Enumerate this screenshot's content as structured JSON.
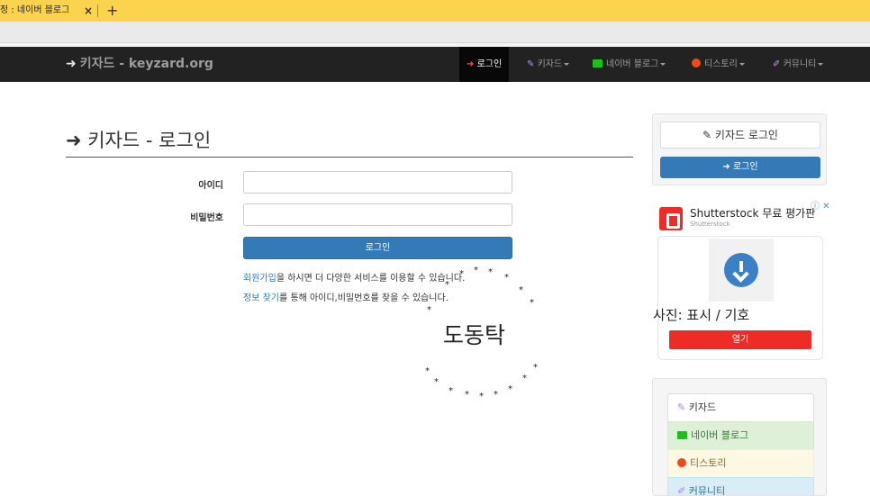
{
  "browser": {
    "tab_title": "정 : 네이버 블로그",
    "tab_close": "×",
    "new_tab": "+"
  },
  "navbar": {
    "brand": "키자드 - keyzard.org",
    "items": [
      {
        "label": "로그인"
      },
      {
        "label": "키자드"
      },
      {
        "label": "네이버 블로그"
      },
      {
        "label": "티스토리"
      },
      {
        "label": "커뮤니티"
      }
    ]
  },
  "login": {
    "title": "키자드 - 로그인",
    "id_label": "아이디",
    "id_value": "",
    "pw_label": "비밀번호",
    "pw_value": "",
    "button": "로그인",
    "signup_link": "회원가입",
    "signup_text": "을 하시면 더 다양한 서비스를 이용할 수 있습니다.",
    "find_link": "정보 찾기",
    "find_text": "를 통해 아이디,비밀번호를 찾을 수 있습니다."
  },
  "overlay": {
    "text": "도동탁"
  },
  "sidebar": {
    "login_title": "키자드 로그인",
    "login_button": "로그인",
    "ad": {
      "name": "Shutterstock 무료 평가판",
      "advertiser": "Shutterstock",
      "caption": "사진: 표시 / 기호",
      "open_button": "열기"
    },
    "menu": [
      {
        "label": "키자드"
      },
      {
        "label": "네이버 블로그"
      },
      {
        "label": "티스토리"
      },
      {
        "label": "커뮤니티"
      }
    ]
  },
  "colors": {
    "tab_bar": "#fcd34d",
    "navbar": "#222222",
    "primary": "#337ab7",
    "ad_red": "#ee2b24"
  }
}
